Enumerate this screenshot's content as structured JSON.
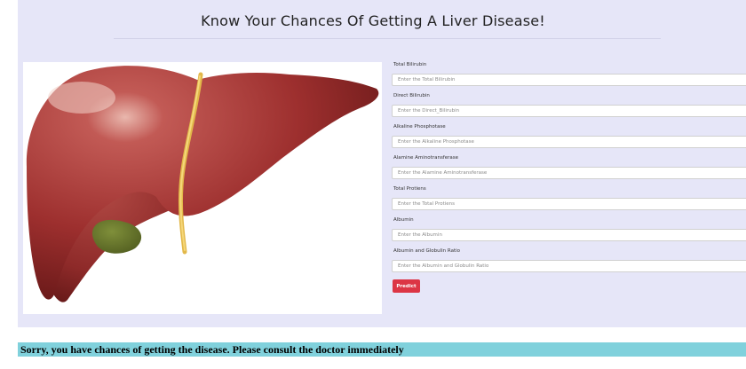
{
  "colors": {
    "panel_background": "#e6e6f8",
    "predict_button": "#dc3545",
    "result_background": "#80d1dc"
  },
  "header": {
    "title": "Know Your Chances Of Getting A Liver Disease!"
  },
  "illustration": {
    "subject": "liver-illustration"
  },
  "form": {
    "fields": [
      {
        "label": "Total Bilirubin",
        "placeholder": "Enter the Total Bilirubin",
        "value": ""
      },
      {
        "label": "Direct Bilirubin",
        "placeholder": "Enter the Direct_Bilirubin",
        "value": ""
      },
      {
        "label": "Alkaline Phosphotase",
        "placeholder": "Enter the Alkaline Phosphotase",
        "value": ""
      },
      {
        "label": "Alamine Aminotransferase",
        "placeholder": "Enter the Alamine Aminotransferase",
        "value": ""
      },
      {
        "label": "Total Protiens",
        "placeholder": "Enter the Total Protiens",
        "value": ""
      },
      {
        "label": "Albumin",
        "placeholder": "Enter the Albumin",
        "value": ""
      },
      {
        "label": "Albumin and Globulin Ratio",
        "placeholder": "Enter the Albumin and Globulin Ratio",
        "value": ""
      }
    ],
    "submit_label": "Predict"
  },
  "result": {
    "message": "Sorry, you have chances of getting the disease. Please consult the doctor immediately"
  }
}
